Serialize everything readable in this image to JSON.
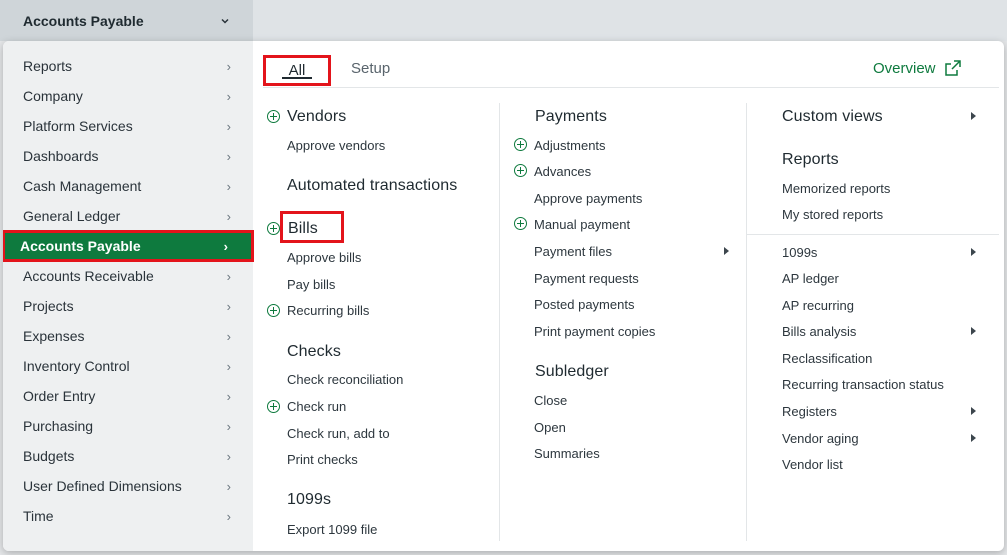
{
  "module_selector": {
    "label": "Accounts Payable",
    "icon": "chevron-down-icon"
  },
  "left_nav": [
    {
      "label": "Reports"
    },
    {
      "label": "Company"
    },
    {
      "label": "Platform Services"
    },
    {
      "label": "Dashboards"
    },
    {
      "label": "Cash Management"
    },
    {
      "label": "General Ledger"
    },
    {
      "label": "Accounts Payable",
      "active": true
    },
    {
      "label": "Accounts Receivable"
    },
    {
      "label": "Projects"
    },
    {
      "label": "Expenses"
    },
    {
      "label": "Inventory Control"
    },
    {
      "label": "Order Entry"
    },
    {
      "label": "Purchasing"
    },
    {
      "label": "Budgets"
    },
    {
      "label": "User Defined Dimensions"
    },
    {
      "label": "Time"
    }
  ],
  "tabs": {
    "all": "All",
    "setup": "Setup",
    "overview": "Overview"
  },
  "col1": {
    "vendors": {
      "title": "Vendors",
      "items": [
        "Approve vendors"
      ]
    },
    "automated": {
      "title": "Automated transactions"
    },
    "bills": {
      "title": "Bills",
      "items": [
        "Approve bills",
        "Pay bills",
        "Recurring bills"
      ]
    },
    "checks": {
      "title": "Checks",
      "items": [
        "Check reconciliation",
        "Check run",
        "Check run, add to",
        "Print checks"
      ]
    },
    "t1099": {
      "title": "1099s",
      "items": [
        "Export 1099 file"
      ]
    }
  },
  "col2": {
    "payments": {
      "title": "Payments",
      "items": [
        "Adjustments",
        "Advances",
        "Approve payments",
        "Manual payment",
        "Payment files",
        "Payment requests",
        "Posted payments",
        "Print payment copies"
      ]
    },
    "subledger": {
      "title": "Subledger",
      "items": [
        "Close",
        "Open",
        "Summaries"
      ]
    }
  },
  "col3": {
    "custom_views": {
      "title": "Custom views"
    },
    "reports": {
      "title": "Reports",
      "items": [
        "Memorized reports",
        "My stored reports"
      ]
    },
    "more": [
      "1099s",
      "AP ledger",
      "AP recurring",
      "Bills analysis",
      "Reclassification",
      "Recurring transaction status",
      "Registers",
      "Vendor aging",
      "Vendor list"
    ]
  },
  "colors": {
    "accent_green": "#0e7a3e",
    "highlight_red": "#e3141b"
  }
}
